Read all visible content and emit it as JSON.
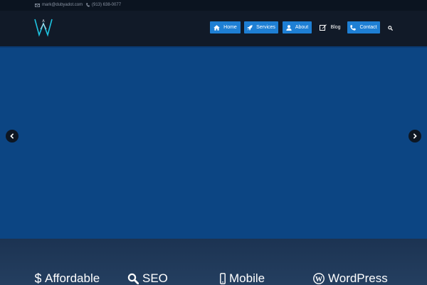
{
  "topbar": {
    "email": "mark@dubyadot.com",
    "phone": "(913) 638-0077"
  },
  "logo": {
    "letters": "W",
    "accent": "#1ec3e0"
  },
  "nav": {
    "items": [
      {
        "label": "Home",
        "icon": "home-icon",
        "style": "button"
      },
      {
        "label": "Services",
        "icon": "rocket-icon",
        "style": "button"
      },
      {
        "label": "About",
        "icon": "user-icon",
        "style": "button"
      },
      {
        "label": "Blog",
        "icon": "edit-icon",
        "style": "plain"
      },
      {
        "label": "Contact",
        "icon": "phone-icon",
        "style": "button"
      }
    ],
    "search_icon": "search-icon"
  },
  "slider": {
    "prev_icon": "chevron-left-icon",
    "next_icon": "chevron-right-icon"
  },
  "features": [
    {
      "label": "Affordable",
      "icon": "dollar-icon"
    },
    {
      "label": "SEO",
      "icon": "search-icon"
    },
    {
      "label": "Mobile",
      "icon": "mobile-icon"
    },
    {
      "label": "WordPress",
      "icon": "wordpress-icon"
    }
  ],
  "colors": {
    "button": "#1e7fd4",
    "slider": "#0c4583",
    "header": "#111a28",
    "topbar": "#0b1420"
  }
}
